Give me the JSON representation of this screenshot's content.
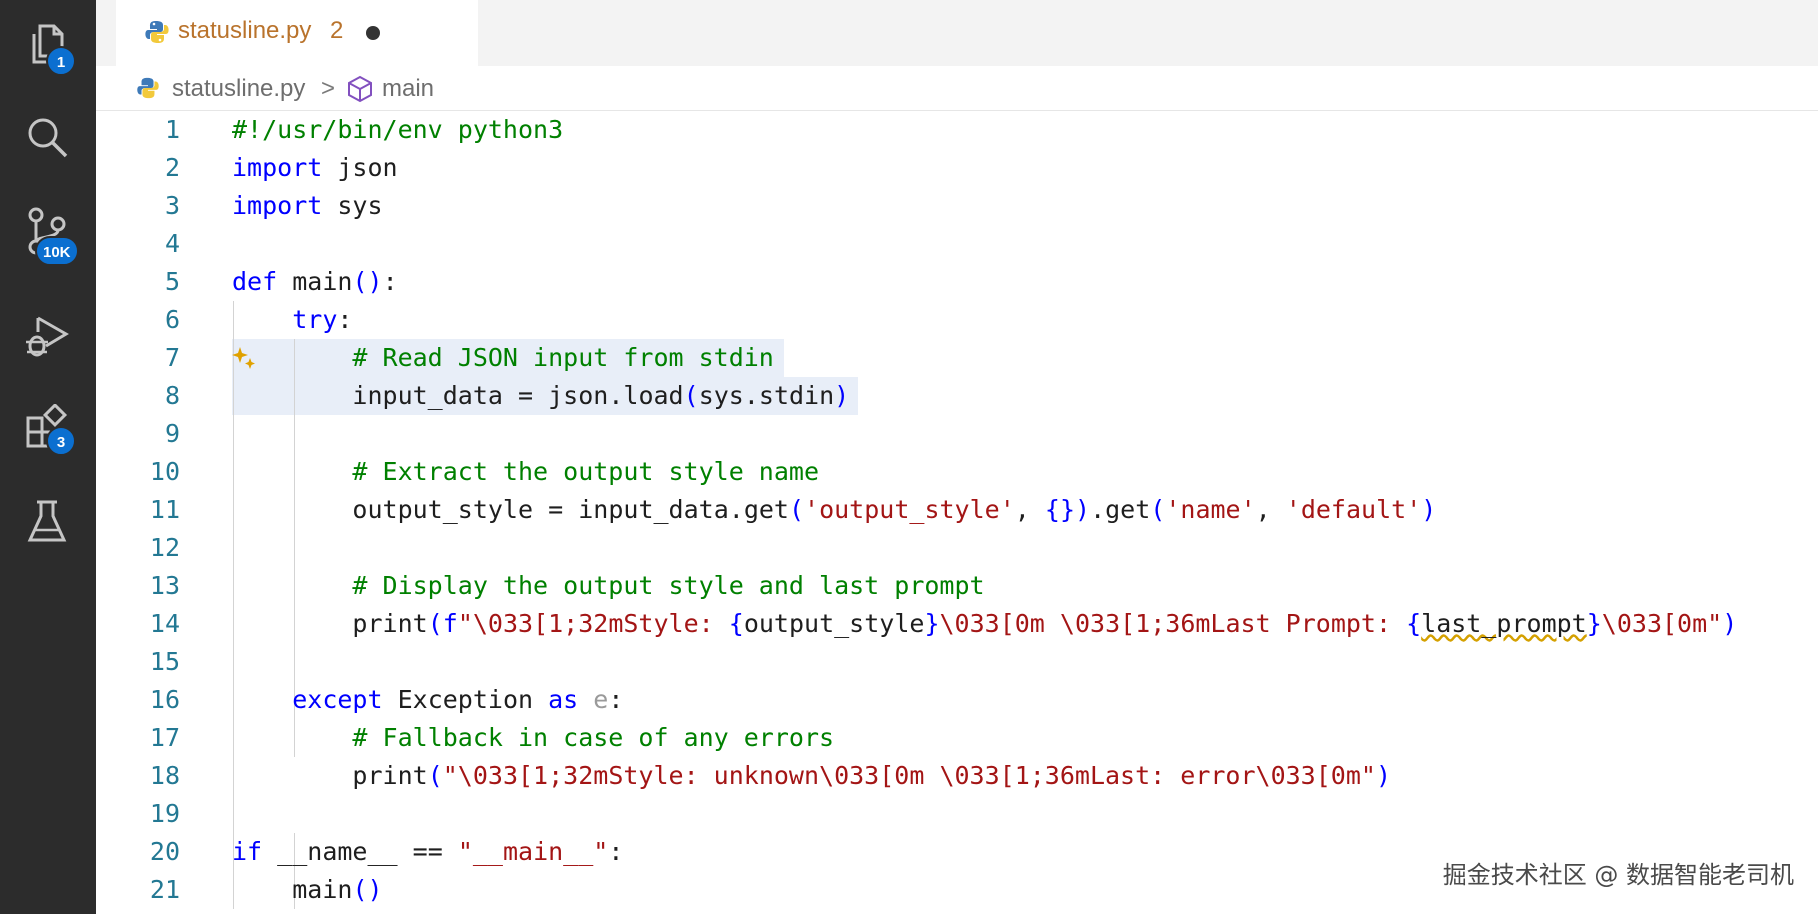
{
  "activity_bar": {
    "items": [
      {
        "name": "explorer",
        "icon": "files-icon",
        "badge": "1"
      },
      {
        "name": "search",
        "icon": "search-icon",
        "badge": ""
      },
      {
        "name": "source-control",
        "icon": "source-control-icon",
        "badge": "10K"
      },
      {
        "name": "run-debug",
        "icon": "run-debug-icon",
        "badge": ""
      },
      {
        "name": "extensions",
        "icon": "extensions-icon",
        "badge": "3"
      },
      {
        "name": "testing",
        "icon": "beaker-icon",
        "badge": ""
      }
    ]
  },
  "tab": {
    "title": "statusline.py",
    "problem_count": "2",
    "icon": "python-icon",
    "dirty": true
  },
  "breadcrumb": {
    "file": "statusline.py",
    "separator": ">",
    "symbol": "main",
    "symbol_icon": "method-cube-icon"
  },
  "code_lines": [
    {
      "n": "1",
      "text": "#!/usr/bin/env python3"
    },
    {
      "n": "2",
      "text": "import json"
    },
    {
      "n": "3",
      "text": "import sys"
    },
    {
      "n": "4",
      "text": ""
    },
    {
      "n": "5",
      "text": "def main():"
    },
    {
      "n": "6",
      "text": "    try:"
    },
    {
      "n": "7",
      "text": "        # Read JSON input from stdin"
    },
    {
      "n": "8",
      "text": "        input_data = json.load(sys.stdin)"
    },
    {
      "n": "9",
      "text": ""
    },
    {
      "n": "10",
      "text": "        # Extract the output style name"
    },
    {
      "n": "11",
      "text": "        output_style = input_data.get('output_style', {}).get('name', 'default')"
    },
    {
      "n": "12",
      "text": ""
    },
    {
      "n": "13",
      "text": "        # Display the output style and last prompt"
    },
    {
      "n": "14",
      "text": "        print(f\"\\033[1;32mStyle: {output_style}\\033[0m \\033[1;36mLast Prompt: {last_prompt}\\033[0m\")"
    },
    {
      "n": "15",
      "text": ""
    },
    {
      "n": "16",
      "text": "    except Exception as e:"
    },
    {
      "n": "17",
      "text": "        # Fallback in case of any errors"
    },
    {
      "n": "18",
      "text": "        print(\"\\033[1;32mStyle: unknown\\033[0m \\033[1;36mLast: error\\033[0m\")"
    },
    {
      "n": "19",
      "text": ""
    },
    {
      "n": "20",
      "text": "if __name__ == \"__main__\":"
    },
    {
      "n": "21",
      "text": "    main()"
    }
  ],
  "watermark": "掘金技术社区 @ 数据智能老司机",
  "colors": {
    "keyword": "#0000ff",
    "comment": "#008000",
    "string": "#a31515",
    "identifier": "#1e1e1e",
    "line_number": "#237893",
    "tab_title": "#b9732c",
    "badge": "#0b6fd0",
    "activity_bar": "#2c2c2c"
  }
}
